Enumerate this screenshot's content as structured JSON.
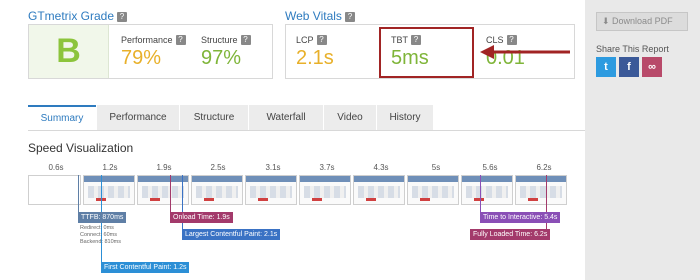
{
  "grade": {
    "title": "GTmetrix Grade",
    "help": "?",
    "letter": "B",
    "performance_label": "Performance",
    "performance_value": "79%",
    "structure_label": "Structure",
    "structure_value": "97%"
  },
  "vitals": {
    "title": "Web Vitals",
    "help": "?",
    "lcp_label": "LCP",
    "lcp_value": "2.1s",
    "tbt_label": "TBT",
    "tbt_value": "5ms",
    "cls_label": "CLS",
    "cls_value": "0.01"
  },
  "sidebar": {
    "download_label": "Download PDF",
    "share_title": "Share This Report",
    "share_twitter": "t",
    "share_facebook": "f",
    "share_link": "∞"
  },
  "tabs": [
    "Summary",
    "Performance",
    "Structure",
    "Waterfall",
    "Video",
    "History"
  ],
  "speed": {
    "title": "Speed Visualization",
    "ticks": [
      "0.6s",
      "1.2s",
      "1.9s",
      "2.5s",
      "3.1s",
      "3.7s",
      "4.3s",
      "5s",
      "5.6s",
      "6.2s"
    ]
  },
  "markers": {
    "ttfb": "TTFB: 870ms",
    "redirect": "Redirect: 0ms",
    "connect": "Connect: 60ms",
    "backend": "Backend: 810ms",
    "fcp": "First Contentful Paint: 1.2s",
    "onload": "Onload Time: 1.9s",
    "lcp": "Largest Contentful Paint: 2.1s",
    "tti": "Time to Interactive: 5.4s",
    "fully_loaded": "Fully Loaded Time: 6.2s"
  },
  "colors": {
    "accent": "#2e7bbf",
    "grade_green": "#8cc43c",
    "metric_yellow": "#e8b02a",
    "metric_green": "#7fb539",
    "highlight_red": "#a12424",
    "marker_blue": "#3a72c4",
    "marker_teal": "#2c8fd6",
    "marker_purple": "#8a4fb6",
    "marker_magenta": "#a33a6b",
    "marker_gray": "#5f7fa6"
  }
}
